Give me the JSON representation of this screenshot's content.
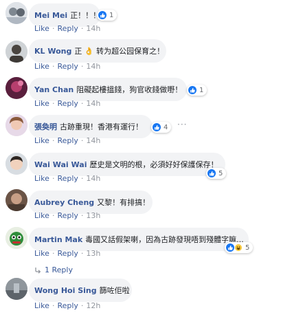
{
  "comments": [
    {
      "name": "Mei Mei",
      "text": "正！！！",
      "reaction_count": "1",
      "like": "Like",
      "reply": "Reply",
      "time": "14h"
    },
    {
      "name": "KL Wong",
      "text": "正 👌 转为超公园保育之！",
      "like": "Like",
      "reply": "Reply",
      "time": "14h"
    },
    {
      "name": "Yan Chan",
      "text": "阻礙起樓搵錢，狗官收錢做嘢！",
      "reaction_count": "1",
      "like": "Like",
      "reply": "Reply",
      "time": "14h"
    },
    {
      "name": "張奐明",
      "text": "古跡重現！香港有運行！",
      "reaction_count": "4",
      "like": "Like",
      "reply": "Reply",
      "time": "14h"
    },
    {
      "name": "Wai Wai Wai",
      "text": "歷史是文明的根，必須好好保護保存！",
      "reaction_count": "5",
      "like": "Like",
      "reply": "Reply",
      "time": "14h"
    },
    {
      "name": "Aubrey Cheng",
      "text": "又黎！有排搞！",
      "like": "Like",
      "reply": "Reply",
      "time": "13h"
    },
    {
      "name": "Martin Mak",
      "text": "毒國又話假架喇，因為古跡發現唔到殘體字嘛...",
      "reaction_count": "5",
      "like": "Like",
      "reply": "Reply",
      "time": "13h"
    },
    {
      "name": "Wong Hoi Sing",
      "text": "篩咗佢啦",
      "like": "Like",
      "reply": "Reply",
      "time": "12h"
    }
  ],
  "replies_link": "1 Reply",
  "colors": {
    "link": "#385898",
    "bubble": "#f2f3f5",
    "like": "#1877f2",
    "meta": "#90949c"
  }
}
